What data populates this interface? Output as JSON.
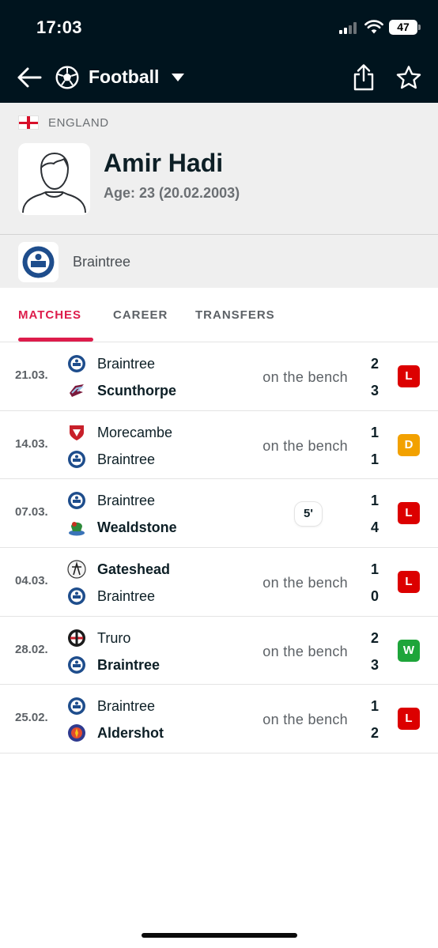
{
  "status_bar": {
    "time": "17:03",
    "battery": "47"
  },
  "header": {
    "title": "Football"
  },
  "player": {
    "country": "ENGLAND",
    "name": "Amir Hadi",
    "age": "Age: 23 (20.02.2003)",
    "club": "Braintree"
  },
  "tabs": [
    "MATCHES",
    "CAREER",
    "TRANSFERS"
  ],
  "colors": {
    "accent": "#dd1c4b",
    "loss": "#dc0000",
    "draw": "#f2a100",
    "win": "#1ea53a",
    "header_bg": "#00141e"
  },
  "matches": [
    {
      "date": "21.03.",
      "home": "Braintree",
      "away": "Scunthorpe",
      "home_icon": "braintree-crest-icon",
      "away_icon": "scunthorpe-crest-icon",
      "home_bold": false,
      "away_bold": true,
      "status": "on the bench",
      "minutes": "",
      "home_score": "2",
      "away_score": "3",
      "result": "L"
    },
    {
      "date": "14.03.",
      "home": "Morecambe",
      "away": "Braintree",
      "home_icon": "morecambe-crest-icon",
      "away_icon": "braintree-crest-icon",
      "home_bold": false,
      "away_bold": false,
      "status": "on the bench",
      "minutes": "",
      "home_score": "1",
      "away_score": "1",
      "result": "D"
    },
    {
      "date": "07.03.",
      "home": "Braintree",
      "away": "Wealdstone",
      "home_icon": "braintree-crest-icon",
      "away_icon": "wealdstone-crest-icon",
      "home_bold": false,
      "away_bold": true,
      "status": "",
      "minutes": "5'",
      "home_score": "1",
      "away_score": "4",
      "result": "L"
    },
    {
      "date": "04.03.",
      "home": "Gateshead",
      "away": "Braintree",
      "home_icon": "gateshead-crest-icon",
      "away_icon": "braintree-crest-icon",
      "home_bold": true,
      "away_bold": false,
      "status": "on the bench",
      "minutes": "",
      "home_score": "1",
      "away_score": "0",
      "result": "L"
    },
    {
      "date": "28.02.",
      "home": "Truro",
      "away": "Braintree",
      "home_icon": "truro-crest-icon",
      "away_icon": "braintree-crest-icon",
      "home_bold": false,
      "away_bold": true,
      "status": "on the bench",
      "minutes": "",
      "home_score": "2",
      "away_score": "3",
      "result": "W"
    },
    {
      "date": "25.02.",
      "home": "Braintree",
      "away": "Aldershot",
      "home_icon": "braintree-crest-icon",
      "away_icon": "aldershot-crest-icon",
      "home_bold": false,
      "away_bold": true,
      "status": "on the bench",
      "minutes": "",
      "home_score": "1",
      "away_score": "2",
      "result": "L"
    }
  ]
}
